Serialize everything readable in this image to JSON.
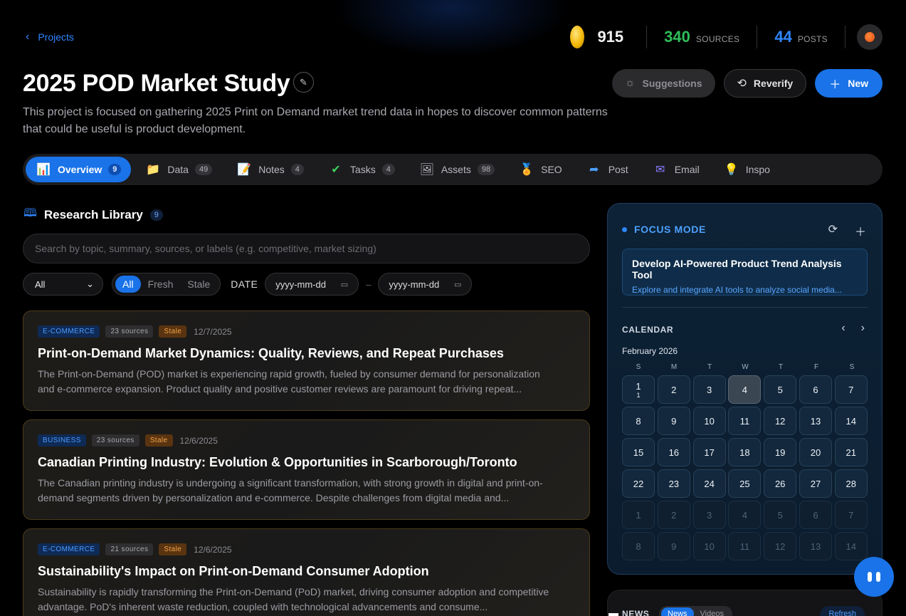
{
  "nav": {
    "back_label": "Projects"
  },
  "stats": {
    "coins": "915",
    "sources": {
      "value": "340",
      "label": "SOURCES",
      "color": "#2fbf5a"
    },
    "posts": {
      "value": "44",
      "label": "POSTS",
      "color": "#2f86ff"
    }
  },
  "project": {
    "title": "2025 POD Market Study",
    "description": "This project is focused on gathering 2025 Print on Demand market trend data in hopes to discover common patterns that could be useful is product development."
  },
  "actions": {
    "suggestions": "Suggestions",
    "reverify": "Reverify",
    "new": "New"
  },
  "tabs": [
    {
      "label": "Overview",
      "count": "9",
      "icon": "chart-icon"
    },
    {
      "label": "Data",
      "count": "49",
      "icon": "folder-icon"
    },
    {
      "label": "Notes",
      "count": "4",
      "icon": "notepad-icon"
    },
    {
      "label": "Tasks",
      "count": "4",
      "icon": "check-icon"
    },
    {
      "label": "Assets",
      "count": "98",
      "icon": "assets-icon"
    },
    {
      "label": "SEO",
      "count": "",
      "icon": "medal-icon"
    },
    {
      "label": "Post",
      "count": "",
      "icon": "share-arrow-icon"
    },
    {
      "label": "Email",
      "count": "",
      "icon": "envelope-icon"
    },
    {
      "label": "Inspo",
      "count": "",
      "icon": "lightbulb-icon"
    }
  ],
  "library": {
    "title": "Research Library",
    "count": "9",
    "search_placeholder": "Search by topic, summary, sources, or labels (e.g. competitive, market sizing)",
    "filter_select": "All",
    "freshness": [
      "All",
      "Fresh",
      "Stale"
    ],
    "date_label": "DATE",
    "date_from": "yyyy-mm-dd",
    "date_sep": "–",
    "date_to": "yyyy-mm-dd"
  },
  "cards": [
    {
      "category": "E-COMMERCE",
      "sources": "23 sources",
      "status": "Stale",
      "date": "12/7/2025",
      "title": "Print-on-Demand Market Dynamics: Quality, Reviews, and Repeat Purchases",
      "summary": "The Print-on-Demand (POD) market is experiencing rapid growth, fueled by consumer demand for personalization and e-commerce expansion. Product quality and positive customer reviews are paramount for driving repeat..."
    },
    {
      "category": "BUSINESS",
      "sources": "23 sources",
      "status": "Stale",
      "date": "12/6/2025",
      "title": "Canadian Printing Industry: Evolution & Opportunities in Scarborough/Toronto",
      "summary": "The Canadian printing industry is undergoing a significant transformation, with strong growth in digital and print-on-demand segments driven by personalization and e-commerce. Despite challenges from digital media and..."
    },
    {
      "category": "E-COMMERCE",
      "sources": "21 sources",
      "status": "Stale",
      "date": "12/6/2025",
      "title": "Sustainability's Impact on Print-on-Demand Consumer Adoption",
      "summary": "Sustainability is rapidly transforming the Print-on-Demand (PoD) market, driving consumer adoption and competitive advantage. PoD's inherent waste reduction, coupled with technological advancements and consume..."
    }
  ],
  "focus": {
    "label": "FOCUS MODE",
    "task_title": "Develop AI-Powered Product Trend Analysis Tool",
    "task_sub": "Explore and integrate AI tools to analyze social media..."
  },
  "calendar": {
    "label": "CALENDAR",
    "month": "February 2026",
    "weekdays": [
      "S",
      "M",
      "T",
      "W",
      "T",
      "F",
      "S"
    ],
    "days": [
      {
        "d": "1",
        "sub": "1"
      },
      {
        "d": "2"
      },
      {
        "d": "3"
      },
      {
        "d": "4",
        "today": true
      },
      {
        "d": "5"
      },
      {
        "d": "6"
      },
      {
        "d": "7"
      },
      {
        "d": "8"
      },
      {
        "d": "9"
      },
      {
        "d": "10"
      },
      {
        "d": "11"
      },
      {
        "d": "12"
      },
      {
        "d": "13"
      },
      {
        "d": "14"
      },
      {
        "d": "15"
      },
      {
        "d": "16"
      },
      {
        "d": "17"
      },
      {
        "d": "18"
      },
      {
        "d": "19"
      },
      {
        "d": "20"
      },
      {
        "d": "21"
      },
      {
        "d": "22"
      },
      {
        "d": "23"
      },
      {
        "d": "24"
      },
      {
        "d": "25"
      },
      {
        "d": "26"
      },
      {
        "d": "27"
      },
      {
        "d": "28"
      },
      {
        "d": "1",
        "muted": true
      },
      {
        "d": "2",
        "muted": true
      },
      {
        "d": "3",
        "muted": true
      },
      {
        "d": "4",
        "muted": true
      },
      {
        "d": "5",
        "muted": true
      },
      {
        "d": "6",
        "muted": true
      },
      {
        "d": "7",
        "muted": true
      },
      {
        "d": "8",
        "muted": true
      },
      {
        "d": "9",
        "muted": true
      },
      {
        "d": "10",
        "muted": true
      },
      {
        "d": "11",
        "muted": true
      },
      {
        "d": "12",
        "muted": true
      },
      {
        "d": "13",
        "muted": true
      },
      {
        "d": "14",
        "muted": true
      }
    ]
  },
  "news": {
    "label": "NEWS",
    "tabs": [
      "News",
      "Videos"
    ],
    "refresh": "Refresh"
  },
  "colors": {
    "accent": "#1a73e8",
    "stale": "#f2a44a",
    "background": "#000000"
  }
}
